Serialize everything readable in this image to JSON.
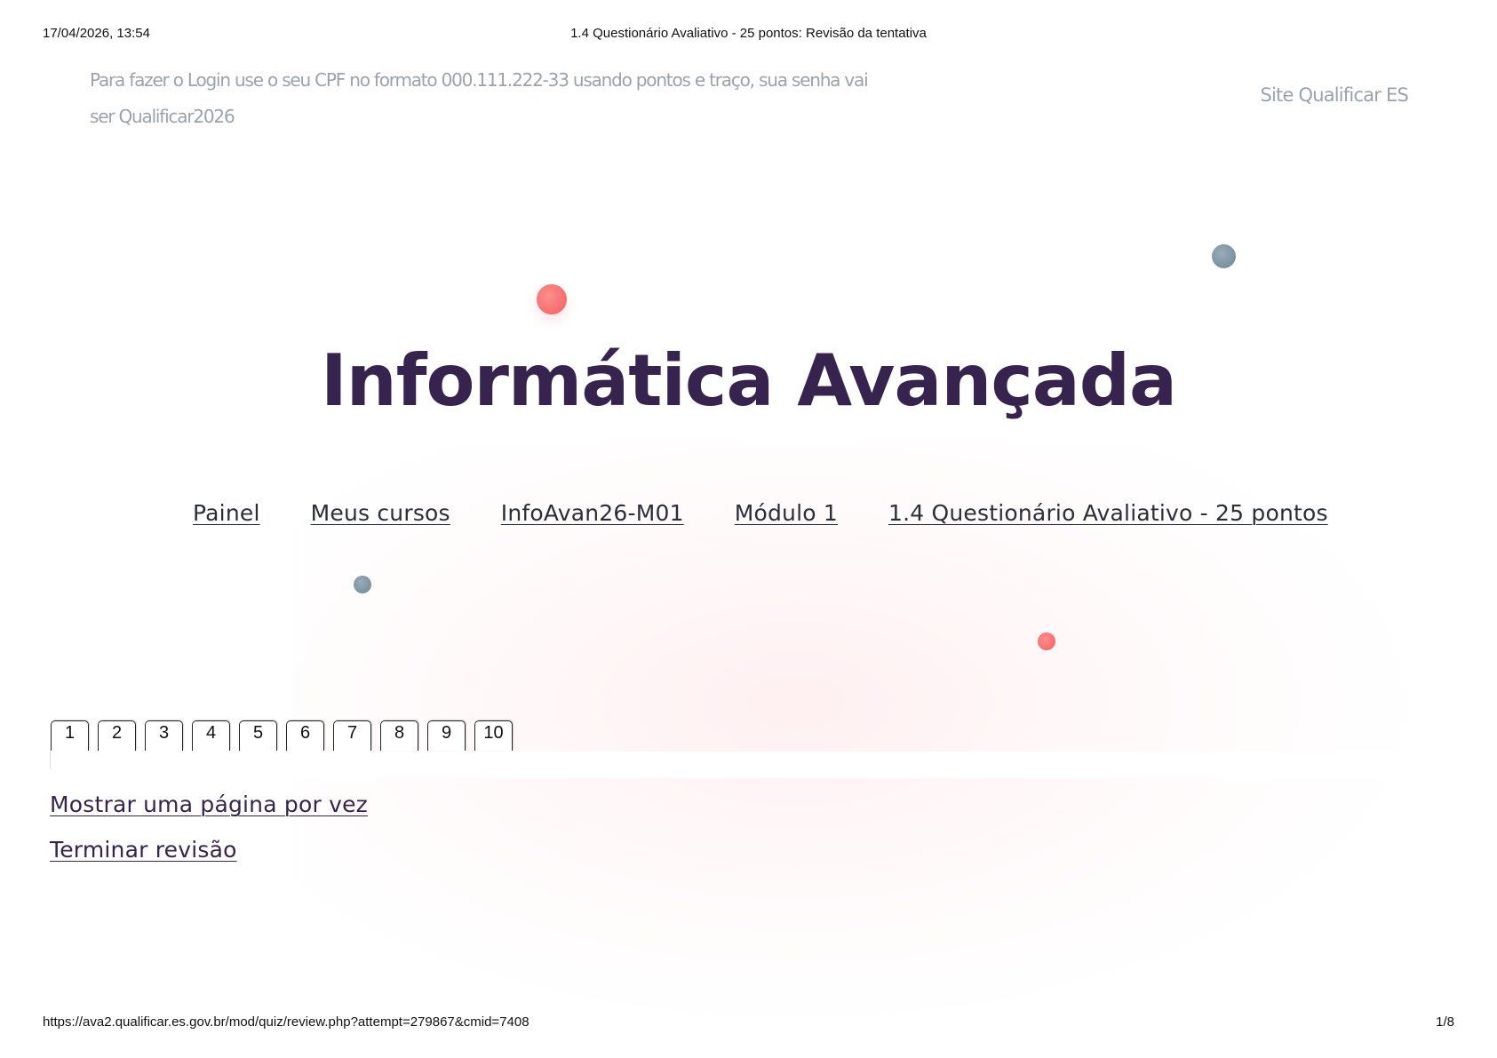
{
  "print_header": {
    "datetime": "17/04/2026, 13:54",
    "title": "1.4 Questionário Avaliativo - 25 pontos: Revisão da tentativa"
  },
  "notice": "Para fazer o Login use o seu CPF no formato 000.111.222-33 usando pontos e traço, sua senha vai ser Qualificar2026",
  "site_link": "Site Qualificar ES",
  "course_title": "Informática Avançada",
  "breadcrumb": [
    "Painel",
    "Meus cursos",
    "InfoAvan26-M01",
    "Módulo 1",
    "1.4 Questionário Avaliativo - 25 pontos"
  ],
  "quiz_navigation": [
    "1",
    "2",
    "3",
    "4",
    "5",
    "6",
    "7",
    "8",
    "9",
    "10"
  ],
  "links": {
    "show_one_page": "Mostrar uma página por vez",
    "finish_review": "Terminar revisão"
  },
  "print_footer": {
    "url": "https://ava2.qualificar.es.gov.br/mod/quiz/review.php?attempt=279867&cmid=7408",
    "page": "1/8"
  },
  "colors": {
    "title": "#36244f",
    "muted_text": "#9aa3ab",
    "accent_red": "#f25f5f",
    "accent_blue": "#6e8798"
  }
}
